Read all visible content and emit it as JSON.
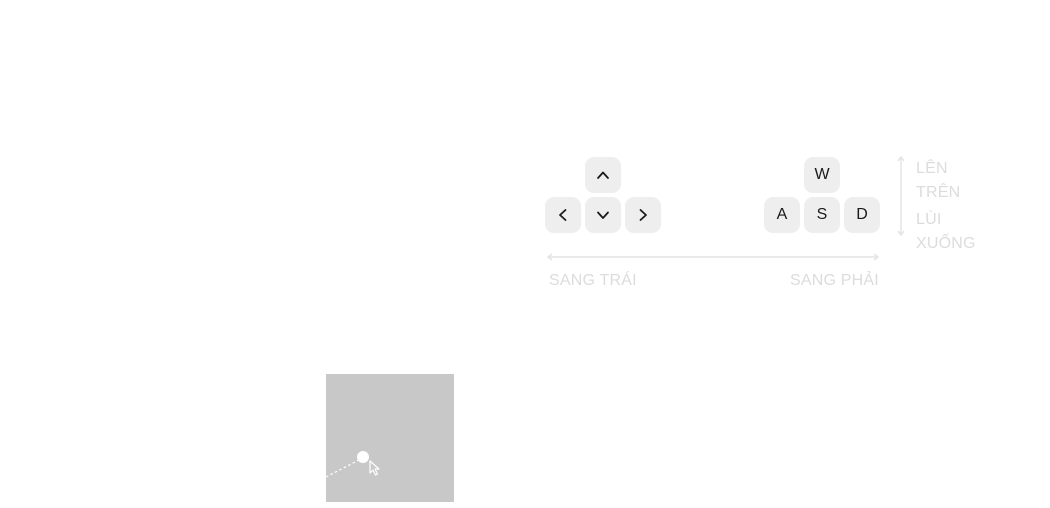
{
  "arrow_keys": {
    "up": "chevron-up-icon",
    "left": "chevron-left-icon",
    "down": "chevron-down-icon",
    "right": "chevron-right-icon"
  },
  "wasd_keys": {
    "w": "W",
    "a": "A",
    "s": "S",
    "d": "D"
  },
  "labels": {
    "left": "SANG TRÁI",
    "right": "SANG PHẢI",
    "up_1": "LÊN",
    "up_2": "TRÊN",
    "down_1": "LÙI",
    "down_2": "XUỐNG"
  },
  "colors": {
    "key_bg": "#eeeeee",
    "label": "#dcdcdc",
    "viewport_bg": "#c8c8c8"
  }
}
